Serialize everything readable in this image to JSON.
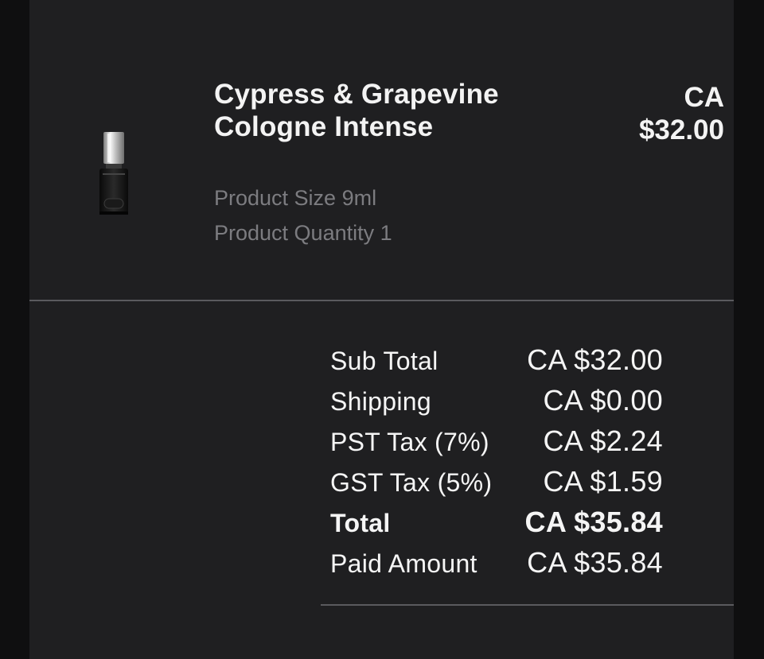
{
  "product": {
    "name": "Cypress & Grapevine Cologne Intense",
    "size": "Product Size 9ml",
    "quantity": "Product Quantity 1",
    "price_line1": "CA",
    "price_line2": "$32.00",
    "image_icon": "cologne-bottle-icon"
  },
  "summary": {
    "rows": [
      {
        "label": "Sub Total",
        "value": "CA $32.00"
      },
      {
        "label": "Shipping",
        "value": "CA $0.00"
      },
      {
        "label": "PST Tax (7%)",
        "value": "CA $2.24"
      },
      {
        "label": "GST Tax (5%)",
        "value": "CA $1.59"
      },
      {
        "label": "Total",
        "value": "CA $35.84"
      },
      {
        "label": "Paid Amount",
        "value": "CA $35.84"
      }
    ]
  },
  "colors": {
    "panel_background": "#1f1f21",
    "outer_background": "#0f0f10",
    "primary_text": "#f3f3f3",
    "secondary_text": "#7c7c80",
    "divider": "#5a5a5e"
  }
}
